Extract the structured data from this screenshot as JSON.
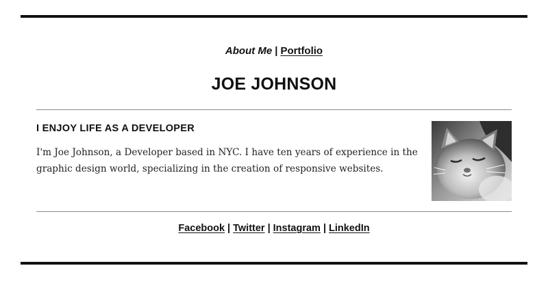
{
  "nav": {
    "about_label": "About Me",
    "separator": "|",
    "portfolio_label": "Portfolio"
  },
  "header": {
    "name": "JOE JOHNSON"
  },
  "about": {
    "heading": "I ENJOY LIFE AS A DEVELOPER",
    "bio": "I'm Joe Johnson, a Developer based in NYC. I have ten years of experience in the graphic design world, specializing in the creation of responsive websites.",
    "photo_subject": "sleeping kitten (grayscale photo)"
  },
  "footer": {
    "separator": "|",
    "links": [
      "Facebook",
      "Twitter",
      "Instagram",
      "LinkedIn"
    ]
  },
  "colors": {
    "text": "#111111",
    "rules": "#111111",
    "divider": "#8a8a8a",
    "background": "#ffffff"
  }
}
